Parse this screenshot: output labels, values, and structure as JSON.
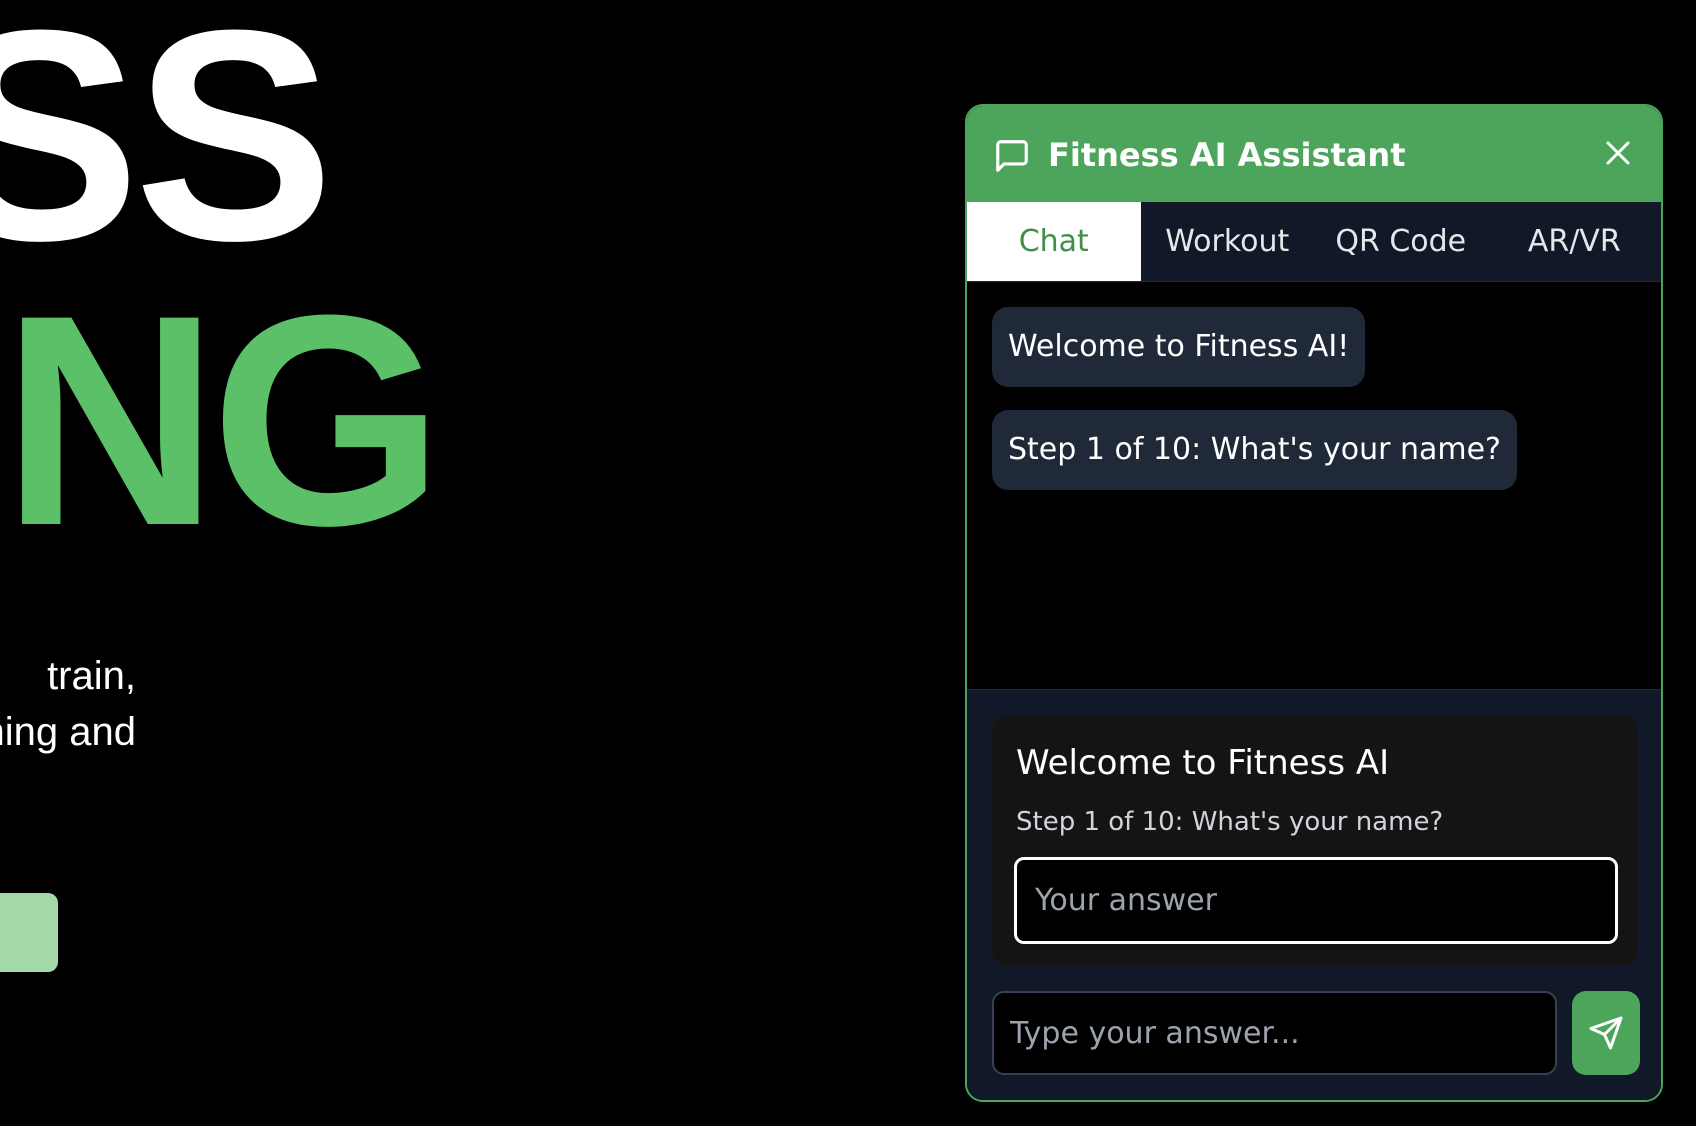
{
  "hero": {
    "line1": "SS",
    "line2": "NING",
    "subtitle_lines": [
      "train,",
      "ning and"
    ],
    "accent_color": "#5cc068",
    "cta_color": "#a3d8a8"
  },
  "widget": {
    "header": {
      "title": "Fitness AI Assistant",
      "icon": "chat-bubble-icon",
      "close_icon": "close-icon",
      "color": "#4ca55a"
    },
    "tabs": [
      {
        "label": "Chat",
        "active": true
      },
      {
        "label": "Workout",
        "active": false
      },
      {
        "label": "QR Code",
        "active": false
      },
      {
        "label": "AR/VR",
        "active": false
      }
    ],
    "messages": [
      {
        "text": "Welcome to Fitness AI!"
      },
      {
        "text": "Step 1 of 10: What's your name?"
      }
    ],
    "step_card": {
      "title": "Welcome to Fitness AI",
      "subtitle": "Step 1 of 10: What's your name?",
      "input_placeholder": "Your answer",
      "input_value": ""
    },
    "composer": {
      "placeholder": "Type your answer...",
      "value": "",
      "send_icon": "send-icon"
    }
  }
}
